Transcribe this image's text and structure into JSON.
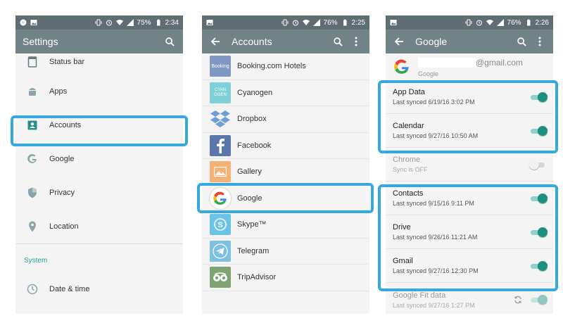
{
  "colors": {
    "accent": "#35a8e0",
    "teal": "#1d8f83",
    "appbar": "#728388",
    "statusbar": "#5f6e72"
  },
  "screen1": {
    "status": {
      "battery": "75%",
      "time": "2:34"
    },
    "title": "Settings",
    "items": [
      {
        "label": "Status bar",
        "icon": "status-bar-icon"
      },
      {
        "label": "Apps",
        "icon": "android-icon"
      },
      {
        "label": "Accounts",
        "icon": "account-box-icon"
      },
      {
        "label": "Google",
        "icon": "google-g-icon"
      },
      {
        "label": "Privacy",
        "icon": "shield-icon"
      },
      {
        "label": "Location",
        "icon": "location-pin-icon"
      }
    ],
    "section": "System",
    "system_items": [
      {
        "label": "Date & time",
        "icon": "clock-icon"
      }
    ]
  },
  "screen2": {
    "status": {
      "battery": "76%",
      "time": "2:25"
    },
    "title": "Accounts",
    "items": [
      {
        "label": "Booking.com Hotels",
        "logo_text": "Booking"
      },
      {
        "label": "Cyanogen",
        "logo_text": "CYAN OGEN"
      },
      {
        "label": "Dropbox"
      },
      {
        "label": "Facebook"
      },
      {
        "label": "Gallery"
      },
      {
        "label": "Google"
      },
      {
        "label": "Skype™"
      },
      {
        "label": "Telegram"
      },
      {
        "label": "TripAdvisor"
      }
    ]
  },
  "screen3": {
    "status": {
      "battery": "76%",
      "time": "2:26"
    },
    "title": "Google",
    "email_suffix": "@gmail.com",
    "account_type": "Google",
    "sync_items": [
      {
        "name": "App Data",
        "sub": "Last synced 6/19/16 3:02 PM",
        "on": true
      },
      {
        "name": "Calendar",
        "sub": "Last synced 9/27/16 10:50 AM",
        "on": true
      },
      {
        "name": "Chrome",
        "sub": "Sync is OFF",
        "on": false
      },
      {
        "name": "Contacts",
        "sub": "Last synced 9/15/16 9:11 PM",
        "on": true
      },
      {
        "name": "Drive",
        "sub": "Last synced 9/26/16 11:21 AM",
        "on": true
      },
      {
        "name": "Gmail",
        "sub": "Last synced 9/27/16 12:30 PM",
        "on": true
      },
      {
        "name": "Google Fit data",
        "sub": "Last synced 9/27/16 1:27 PM",
        "on": true
      }
    ]
  }
}
